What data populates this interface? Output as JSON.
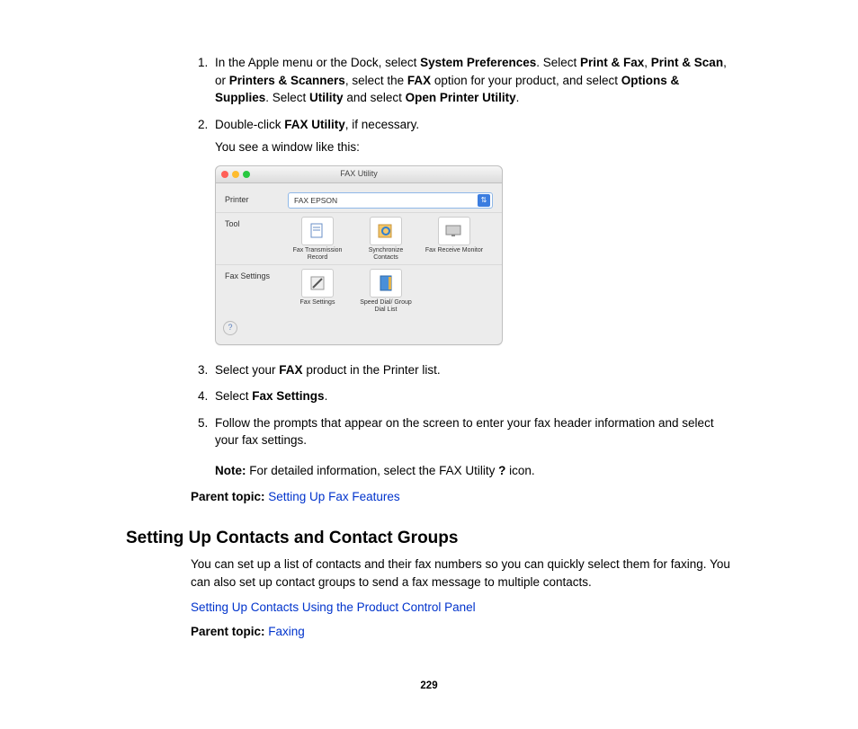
{
  "steps": {
    "s1": {
      "t1": "In the Apple menu or the Dock, select ",
      "b1": "System Preferences",
      "t2": ". Select ",
      "b2": "Print & Fax",
      "t3": ", ",
      "b3": "Print & Scan",
      "t4": ", or ",
      "b4": "Printers & Scanners",
      "t5": ", select the ",
      "b5": "FAX",
      "t6": " option for your product, and select ",
      "b6": "Options & Supplies",
      "t7": ". Select ",
      "b7": "Utility",
      "t8": " and select ",
      "b8": "Open Printer Utility",
      "t9": "."
    },
    "s2": {
      "t1": "Double-click ",
      "b1": "FAX Utility",
      "t2": ", if necessary.",
      "sub": "You see a window like this:"
    },
    "s3": {
      "t1": "Select your ",
      "b1": "FAX",
      "t2": " product in the Printer list."
    },
    "s4": {
      "t1": "Select ",
      "b1": "Fax Settings",
      "t2": "."
    },
    "s5": "Follow the prompts that appear on the screen to enter your fax header information and select your fax settings.",
    "note": {
      "label": "Note:",
      "t1": " For detailed information, select the FAX Utility ",
      "b1": "?",
      "t2": " icon."
    }
  },
  "parent1": {
    "label": "Parent topic:",
    "link": "Setting Up Fax Features"
  },
  "heading": "Setting Up Contacts and Contact Groups",
  "para": "You can set up a list of contacts and their fax numbers so you can quickly select them for faxing. You can also set up contact groups to send a fax message to multiple contacts.",
  "link2": "Setting Up Contacts Using the Product Control Panel",
  "parent2": {
    "label": "Parent topic:",
    "link": "Faxing"
  },
  "pagenum": "229",
  "window": {
    "title": "FAX Utility",
    "printerLabel": "Printer",
    "printerValue": "FAX EPSON",
    "toolLabel": "Tool",
    "settingsLabel": "Fax Settings",
    "tiles": {
      "tx": "Fax Transmission\nRecord",
      "sync": "Synchronize\nContacts",
      "rcv": "Fax Receive\nMonitor",
      "fs": "Fax Settings",
      "sd": "Speed Dial/\nGroup Dial List"
    }
  }
}
